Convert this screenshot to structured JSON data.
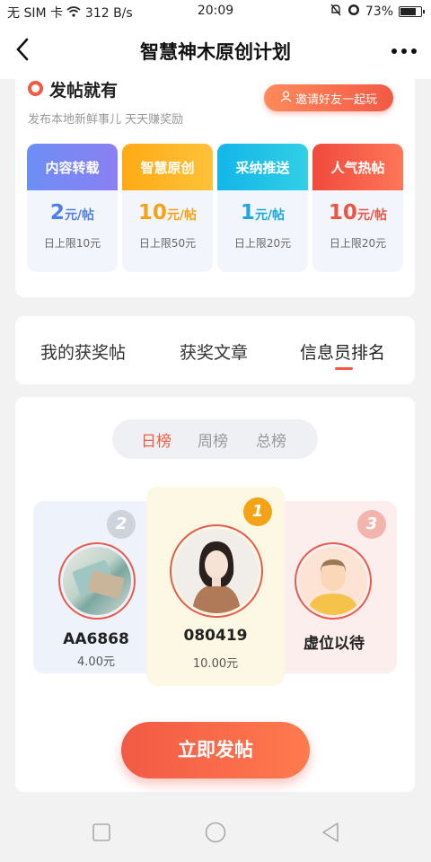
{
  "statusbar": {
    "left": "无 SIM 卡",
    "speed": "312 B/s",
    "time": "20:09",
    "battery": "73%"
  },
  "navbar": {
    "title": "智慧神木原创计划"
  },
  "promo": {
    "heading": "发帖就有",
    "subtitle": "发布本地新鲜事儿 天天赚奖励",
    "invite_label": "邀请好友一起玩"
  },
  "tiles": [
    {
      "title": "内容转载",
      "amount": "2",
      "unit": "元/帖",
      "limit": "日上限10元",
      "color": "#5a8cf2",
      "amount_color": "#4d7fe8"
    },
    {
      "title": "智慧原创",
      "amount": "10",
      "unit": "元/帖",
      "limit": "日上限50元",
      "color": "#ffb11b",
      "amount_color": "#f5a316"
    },
    {
      "title": "采纳推送",
      "amount": "1",
      "unit": "元/帖",
      "limit": "日上限20元",
      "color": "#1ebde8",
      "amount_color": "#1aa8de"
    },
    {
      "title": "人气热帖",
      "amount": "10",
      "unit": "元/帖",
      "limit": "日上限20元",
      "color": "#f25a45",
      "amount_color": "#ec5444"
    }
  ],
  "tabs": [
    "我的获奖帖",
    "获奖文章",
    "信息员排名"
  ],
  "segment": [
    "日榜",
    "周榜",
    "总榜"
  ],
  "ranking": [
    {
      "rank": "2",
      "name": "AA6868",
      "value": "4.00元"
    },
    {
      "rank": "1",
      "name": "080419",
      "value": "10.00元"
    },
    {
      "rank": "3",
      "name": "虚位以待",
      "value": ""
    }
  ],
  "post_button": "立即发帖",
  "colors": {
    "accent": "#f25a45",
    "gold": "#f5a316"
  }
}
